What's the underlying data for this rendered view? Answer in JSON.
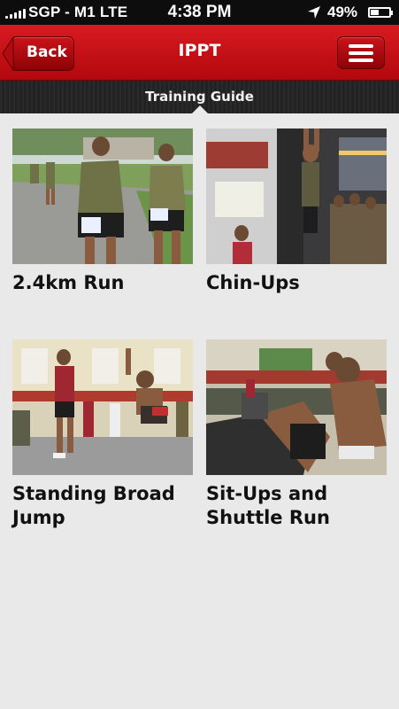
{
  "status_bar": {
    "carrier": "SGP - M1  LTE",
    "time": "4:38 PM",
    "battery": "49%",
    "battery_level": 0.49,
    "signal_bars": 5
  },
  "nav": {
    "back_label": "Back",
    "title": "IPPT",
    "menu_icon": "hamburger-icon"
  },
  "subheader": {
    "title": "Training Guide"
  },
  "colors": {
    "nav_red": "#c8141a",
    "background": "#e9e9ea",
    "subheader_dark": "#262626"
  },
  "guides": [
    {
      "label": "2.4km Run",
      "image": "running-photo"
    },
    {
      "label": "Chin-Ups",
      "image": "chin-ups-photo"
    },
    {
      "label": "Standing Broad Jump",
      "image": "broad-jump-photo"
    },
    {
      "label": "Sit-Ups and Shuttle Run",
      "image": "sit-ups-photo"
    }
  ]
}
